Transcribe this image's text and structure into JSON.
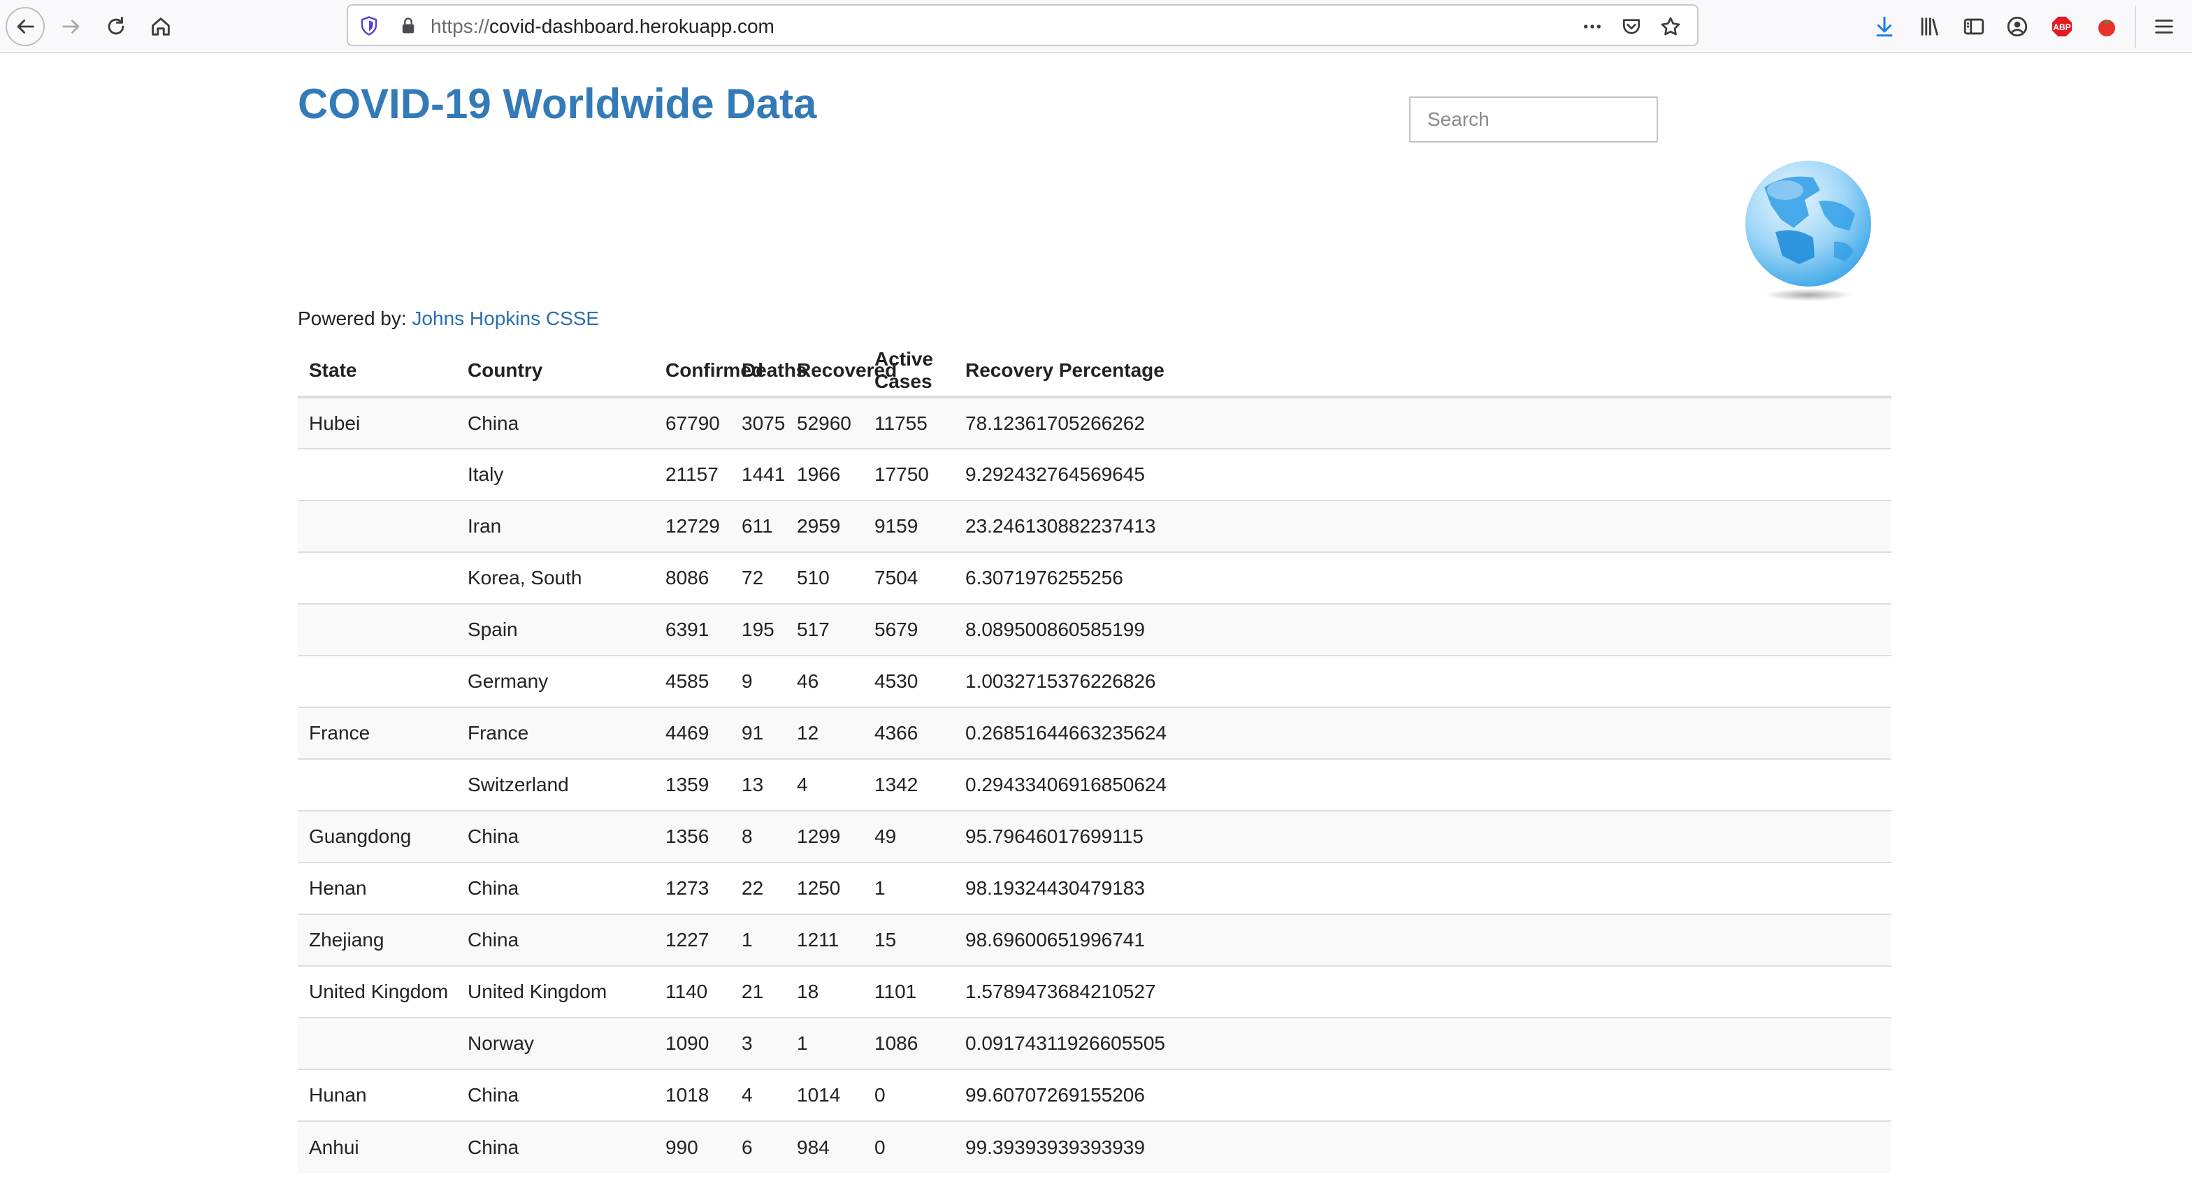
{
  "browser": {
    "url_scheme": "https://",
    "url_host": "covid-dashboard.herokuapp.com",
    "icons": {
      "back": "back-arrow-icon",
      "forward": "forward-arrow-icon",
      "reload": "reload-icon",
      "home": "home-icon",
      "tracking": "tracking-protection-shield-icon",
      "lock": "lock-icon",
      "more": "page-actions-ellipsis-icon",
      "pocket": "pocket-icon",
      "bookmark": "bookmark-star-icon",
      "downloads": "downloads-icon",
      "library": "library-icon",
      "sidebar": "sidebar-icon",
      "account": "account-icon",
      "adblock": "adblock-plus-icon",
      "tomato": "tomato-extension-icon",
      "menu": "hamburger-menu-icon"
    },
    "adblock_label": "ABP"
  },
  "page": {
    "title": "COVID-19 Worldwide Data",
    "search_placeholder": "Search",
    "powered_by_label": "Powered by: ",
    "powered_by_link": "Johns Hopkins CSSE",
    "globe_image": "globe-image",
    "accent_color": "#337ab7"
  },
  "table": {
    "headers": {
      "state": "State",
      "country": "Country",
      "confirmed": "Confirmed",
      "deaths": "Deaths",
      "recovered": "Recovered",
      "active": "Active Cases",
      "recovery_pct": "Recovery Percentage"
    },
    "rows": [
      {
        "state": "Hubei",
        "country": "China",
        "confirmed": "67790",
        "deaths": "3075",
        "recovered": "52960",
        "active": "11755",
        "recovery_pct": "78.12361705266262"
      },
      {
        "state": "",
        "country": "Italy",
        "confirmed": "21157",
        "deaths": "1441",
        "recovered": "1966",
        "active": "17750",
        "recovery_pct": "9.292432764569645"
      },
      {
        "state": "",
        "country": "Iran",
        "confirmed": "12729",
        "deaths": "611",
        "recovered": "2959",
        "active": "9159",
        "recovery_pct": "23.246130882237413"
      },
      {
        "state": "",
        "country": "Korea, South",
        "confirmed": "8086",
        "deaths": "72",
        "recovered": "510",
        "active": "7504",
        "recovery_pct": "6.3071976255256"
      },
      {
        "state": "",
        "country": "Spain",
        "confirmed": "6391",
        "deaths": "195",
        "recovered": "517",
        "active": "5679",
        "recovery_pct": "8.089500860585199"
      },
      {
        "state": "",
        "country": "Germany",
        "confirmed": "4585",
        "deaths": "9",
        "recovered": "46",
        "active": "4530",
        "recovery_pct": "1.0032715376226826"
      },
      {
        "state": "France",
        "country": "France",
        "confirmed": "4469",
        "deaths": "91",
        "recovered": "12",
        "active": "4366",
        "recovery_pct": "0.26851644663235624"
      },
      {
        "state": "",
        "country": "Switzerland",
        "confirmed": "1359",
        "deaths": "13",
        "recovered": "4",
        "active": "1342",
        "recovery_pct": "0.29433406916850624"
      },
      {
        "state": "Guangdong",
        "country": "China",
        "confirmed": "1356",
        "deaths": "8",
        "recovered": "1299",
        "active": "49",
        "recovery_pct": "95.79646017699115"
      },
      {
        "state": "Henan",
        "country": "China",
        "confirmed": "1273",
        "deaths": "22",
        "recovered": "1250",
        "active": "1",
        "recovery_pct": "98.19324430479183"
      },
      {
        "state": "Zhejiang",
        "country": "China",
        "confirmed": "1227",
        "deaths": "1",
        "recovered": "1211",
        "active": "15",
        "recovery_pct": "98.69600651996741"
      },
      {
        "state": "United Kingdom",
        "country": "United Kingdom",
        "confirmed": "1140",
        "deaths": "21",
        "recovered": "18",
        "active": "1101",
        "recovery_pct": "1.5789473684210527"
      },
      {
        "state": "",
        "country": "Norway",
        "confirmed": "1090",
        "deaths": "3",
        "recovered": "1",
        "active": "1086",
        "recovery_pct": "0.09174311926605505"
      },
      {
        "state": "Hunan",
        "country": "China",
        "confirmed": "1018",
        "deaths": "4",
        "recovered": "1014",
        "active": "0",
        "recovery_pct": "99.60707269155206"
      },
      {
        "state": "Anhui",
        "country": "China",
        "confirmed": "990",
        "deaths": "6",
        "recovered": "984",
        "active": "0",
        "recovery_pct": "99.39393939393939"
      }
    ]
  }
}
